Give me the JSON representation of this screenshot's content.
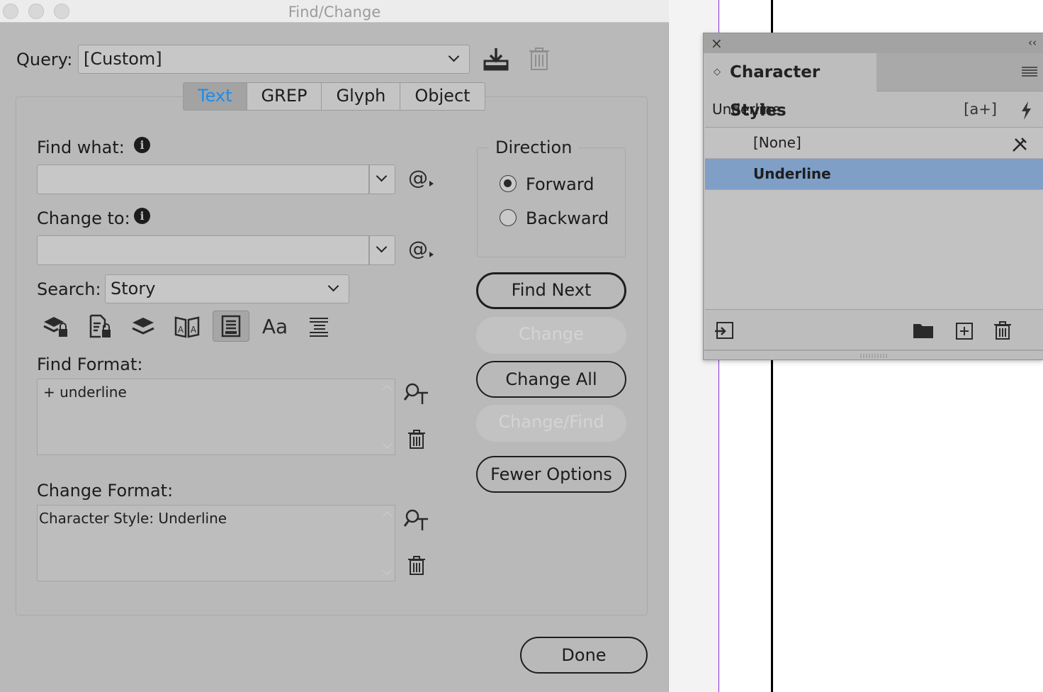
{
  "window": {
    "title": "Find/Change"
  },
  "query": {
    "label": "Query:",
    "value": "[Custom]"
  },
  "tabs": [
    {
      "label": "Text",
      "active": true
    },
    {
      "label": "GREP",
      "active": false
    },
    {
      "label": "Glyph",
      "active": false
    },
    {
      "label": "Object",
      "active": false
    }
  ],
  "find_what": {
    "label": "Find what:",
    "value": ""
  },
  "change_to": {
    "label": "Change to:",
    "value": ""
  },
  "search": {
    "label": "Search:",
    "value": "Story"
  },
  "search_options": [
    {
      "icon": "include-locked-layers-icon",
      "active": false
    },
    {
      "icon": "include-locked-stories-icon",
      "active": false
    },
    {
      "icon": "include-hidden-layers-icon",
      "active": false
    },
    {
      "icon": "include-master-pages-icon",
      "active": false
    },
    {
      "icon": "include-footnotes-icon",
      "active": true
    },
    {
      "icon": "case-sensitive-icon",
      "active": false
    },
    {
      "icon": "whole-word-icon",
      "active": false
    }
  ],
  "case_sensitive_glyph": "Aa",
  "direction": {
    "label": "Direction",
    "options": [
      {
        "label": "Forward",
        "checked": true
      },
      {
        "label": "Backward",
        "checked": false
      }
    ]
  },
  "buttons": {
    "find_next": "Find Next",
    "change": "Change",
    "change_all": "Change All",
    "change_find": "Change/Find",
    "fewer_options": "Fewer Options",
    "done": "Done"
  },
  "find_format": {
    "label": "Find Format:",
    "value": "+ underline"
  },
  "change_format": {
    "label": "Change Format:",
    "value": "Character Style: Underline"
  },
  "panel": {
    "tab_title": "Character Styles",
    "current_style": "Underline",
    "styles": [
      {
        "name": "[None]",
        "selected": false
      },
      {
        "name": "Underline",
        "selected": true
      }
    ]
  },
  "colors": {
    "dialog_bg": "#b9b9b9",
    "active_tab_text": "#1a8cf0",
    "selected_row": "#7f9fc7",
    "doc_guide": "#8a2be2"
  }
}
